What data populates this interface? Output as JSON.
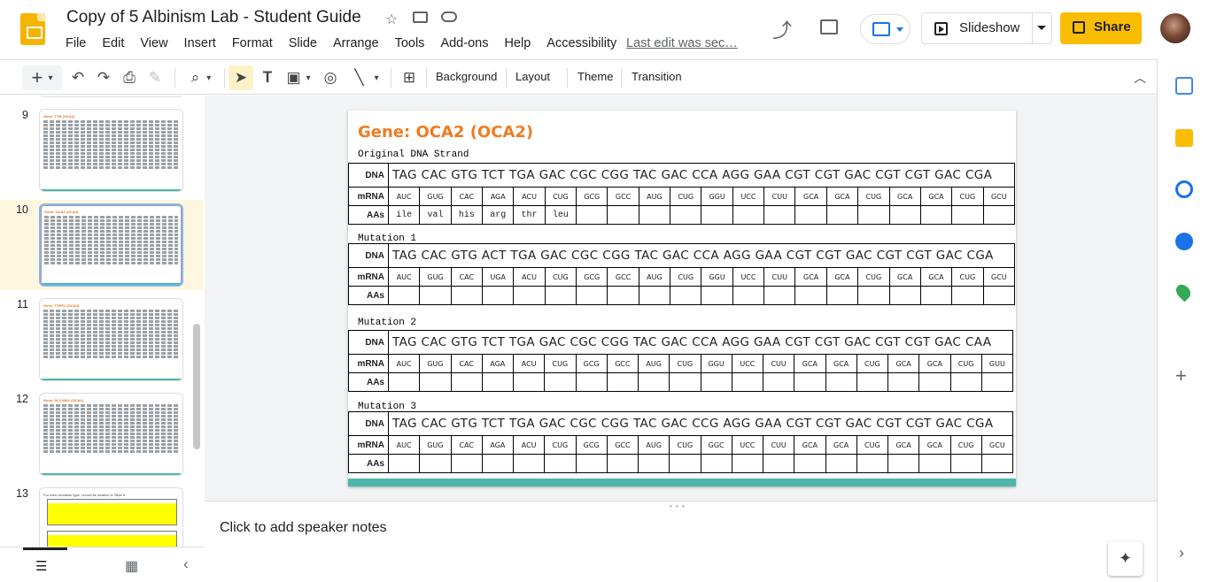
{
  "header": {
    "doc_title": "Copy of 5 Albinism Lab - Student Guide",
    "menus": [
      "File",
      "Edit",
      "View",
      "Insert",
      "Format",
      "Slide",
      "Arrange",
      "Tools",
      "Add-ons",
      "Help",
      "Accessibility"
    ],
    "last_edit": "Last edit was sec…",
    "slideshow_label": "Slideshow",
    "share_label": "Share"
  },
  "toolbar": {
    "background_label": "Background",
    "layout_label": "Layout",
    "theme_label": "Theme",
    "transition_label": "Transition"
  },
  "filmstrip": {
    "slides": [
      {
        "num": "9",
        "title": "Gene: TYR (OCA1)"
      },
      {
        "num": "10",
        "title": "Gene: OCA2 (OCA2)",
        "selected": true
      },
      {
        "num": "11",
        "title": "Gene: TYRP1 (OCA3)"
      },
      {
        "num": "12",
        "title": "Gene: SLC45A2 (OCA4)"
      },
      {
        "num": "13",
        "title": "For each mutation type, record its location in Slide 5"
      }
    ]
  },
  "slide": {
    "title": "Gene: OCA2 (OCA2)",
    "row_labels": {
      "dna": "DNA",
      "mrna": "mRNA",
      "aas": "AAs"
    },
    "sections": [
      {
        "label": "Original DNA Strand",
        "dna": "TAG CAC GTG TCT TGA GAC CGC CGG TAC GAC CCA AGG GAA CGT CGT GAC CGT CGT GAC CGA",
        "mrna": [
          "AUC",
          "GUG",
          "CAC",
          "AGA",
          "ACU",
          "CUG",
          "GCG",
          "GCC",
          "AUG",
          "CUG",
          "GGU",
          "UCC",
          "CUU",
          "GCA",
          "GCA",
          "CUG",
          "GCA",
          "GCA",
          "CUG",
          "GCU"
        ],
        "aas": [
          "ile",
          "val",
          "his",
          "arg",
          "thr",
          "leu",
          "",
          "",
          "",
          "",
          "",
          "",
          "",
          "",
          "",
          "",
          "",
          "",
          "",
          ""
        ]
      },
      {
        "label": "Mutation 1",
        "dna": "TAG CAC GTG ACT TGA GAC CGC CGG TAC GAC CCA AGG GAA CGT CGT GAC CGT CGT GAC CGA",
        "mrna": [
          "AUC",
          "GUG",
          "CAC",
          "UGA",
          "ACU",
          "CUG",
          "GCG",
          "GCC",
          "AUG",
          "CUG",
          "GGU",
          "UCC",
          "CUU",
          "GCA",
          "GCA",
          "CUG",
          "GCA",
          "GCA",
          "CUG",
          "GCU"
        ],
        "aas": [
          "",
          "",
          "",
          "",
          "",
          "",
          "",
          "",
          "",
          "",
          "",
          "",
          "",
          "",
          "",
          "",
          "",
          "",
          "",
          ""
        ]
      },
      {
        "label": "Mutation 2",
        "dna": "TAG CAC GTG TCT TGA GAC CGC CGG TAC GAC CCA AGG GAA CGT CGT GAC CGT CGT GAC CAA",
        "mrna": [
          "AUC",
          "GUG",
          "CAC",
          "AGA",
          "ACU",
          "CUG",
          "GCG",
          "GCC",
          "AUG",
          "CUG",
          "GGU",
          "UCC",
          "CUU",
          "GCA",
          "GCA",
          "CUG",
          "GCA",
          "GCA",
          "CUG",
          "GUU"
        ],
        "aas": [
          "",
          "",
          "",
          "",
          "",
          "",
          "",
          "",
          "",
          "",
          "",
          "",
          "",
          "",
          "",
          "",
          "",
          "",
          "",
          ""
        ]
      },
      {
        "label": "Mutation 3",
        "dna": "TAG CAC GTG TCT TGA GAC CGC CGG TAC GAC CCG AGG GAA CGT CGT GAC CGT CGT GAC CGA",
        "mrna": [
          "AUC",
          "GUG",
          "CAC",
          "AGA",
          "ACU",
          "CUG",
          "GCG",
          "GCC",
          "AUG",
          "CUG",
          "GGC",
          "UCC",
          "CUU",
          "GCA",
          "GCA",
          "CUG",
          "GCA",
          "GCA",
          "CUG",
          "GCU"
        ],
        "aas": [
          "",
          "",
          "",
          "",
          "",
          "",
          "",
          "",
          "",
          "",
          "",
          "",
          "",
          "",
          "",
          "",
          "",
          "",
          "",
          ""
        ]
      }
    ]
  },
  "notes": {
    "placeholder": "Click to add speaker notes"
  },
  "colors": {
    "share": "#fbbc04",
    "title_orange": "#f07b22",
    "teal": "#4db6ac",
    "selected_band": "#fef7e0"
  }
}
